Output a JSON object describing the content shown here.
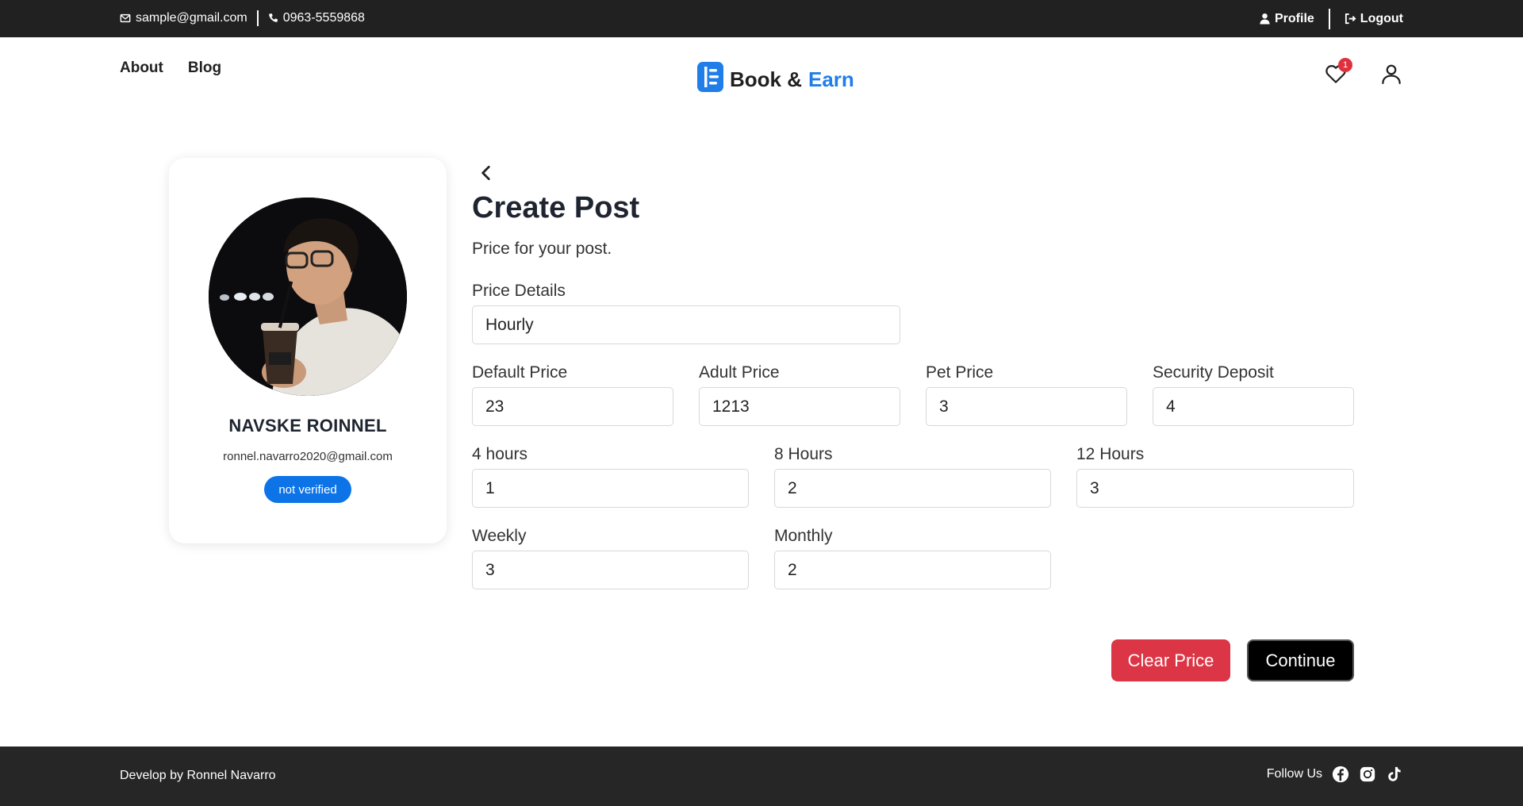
{
  "topbar": {
    "email": "sample@gmail.com",
    "phone": "0963-5559868",
    "profile_label": "Profile",
    "logout_label": "Logout"
  },
  "nav": {
    "links": [
      "About",
      "Blog"
    ],
    "brand_part1": "Book &",
    "brand_part2": "Earn",
    "wishlist_count": "1"
  },
  "profile": {
    "name": "NAVSKE ROINNEL",
    "email": "ronnel.navarro2020@gmail.com",
    "status": "not verified"
  },
  "form": {
    "title": "Create Post",
    "subtitle": "Price for your post.",
    "price_details": {
      "label": "Price Details",
      "value": "Hourly"
    },
    "default_price": {
      "label": "Default Price",
      "value": "23"
    },
    "adult_price": {
      "label": "Adult Price",
      "value": "1213"
    },
    "pet_price": {
      "label": "Pet Price",
      "value": "3"
    },
    "security_deposit": {
      "label": "Security Deposit",
      "value": "4"
    },
    "hours_4": {
      "label": "4 hours",
      "value": "1"
    },
    "hours_8": {
      "label": "8 Hours",
      "value": "2"
    },
    "hours_12": {
      "label": "12 Hours",
      "value": "3"
    },
    "weekly": {
      "label": "Weekly",
      "value": "3"
    },
    "monthly": {
      "label": "Monthly",
      "value": "2"
    },
    "clear_label": "Clear Price",
    "continue_label": "Continue"
  },
  "footer": {
    "credit": "Develop by Ronnel Navarro",
    "follow_label": "Follow Us"
  },
  "colors": {
    "brand_blue": "#1f7ee8",
    "badge_blue": "#0d74e8",
    "danger": "#dc3545",
    "dark_bar": "#212121"
  }
}
